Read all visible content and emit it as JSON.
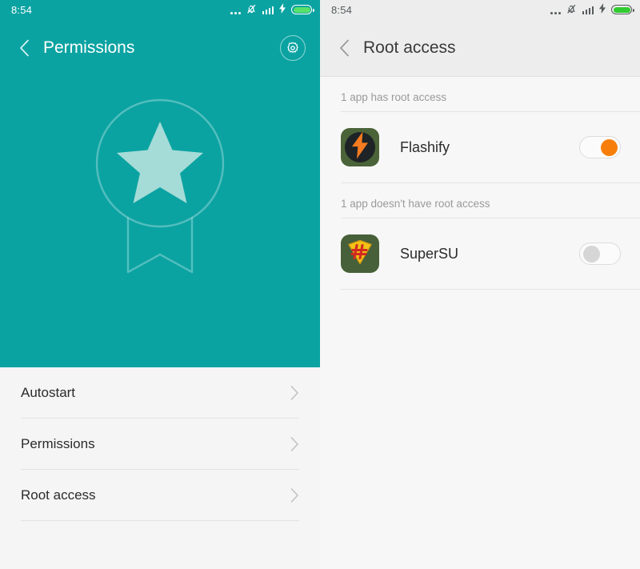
{
  "colors": {
    "teal": "#0ba3a2",
    "accent_orange": "#f77f09",
    "battery_green": "#31cc31",
    "header_gray": "#ededed",
    "content_gray": "#f7f7f7"
  },
  "left_panel": {
    "status_bar": {
      "time": "8:54",
      "icons": [
        "more-dots-icon",
        "silent-bell-icon",
        "signal-bars-icon",
        "charging-bolt-icon",
        "battery-icon"
      ]
    },
    "header": {
      "back_label": "back-chevron-icon",
      "title": "Permissions",
      "settings_label": "gear-icon"
    },
    "hero": {
      "art": "award-badge-medal-illustration"
    },
    "items": [
      {
        "label": "Autostart",
        "chevron": "chevron-right-icon"
      },
      {
        "label": "Permissions",
        "chevron": "chevron-right-icon"
      },
      {
        "label": "Root access",
        "chevron": "chevron-right-icon"
      }
    ]
  },
  "right_panel": {
    "status_bar": {
      "time": "8:54",
      "icons": [
        "more-dots-icon",
        "silent-bell-icon",
        "signal-bars-icon",
        "charging-bolt-icon",
        "battery-icon"
      ]
    },
    "header": {
      "back_label": "back-chevron-icon",
      "title": "Root access"
    },
    "sections": [
      {
        "heading": "1 app has root access",
        "apps": [
          {
            "name": "Flashify",
            "icon": "flashify-app-icon",
            "toggle_state": "on"
          }
        ]
      },
      {
        "heading": "1 app doesn't have root access",
        "apps": [
          {
            "name": "SuperSU",
            "icon": "supersu-app-icon",
            "toggle_state": "off"
          }
        ]
      }
    ]
  }
}
